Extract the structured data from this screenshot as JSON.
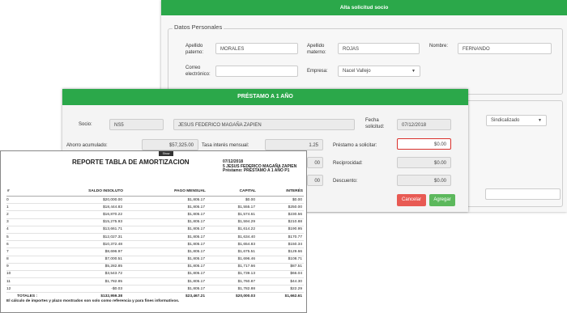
{
  "alta": {
    "title": "Alta solicitud socio",
    "section": "Datos Personales",
    "apellido_paterno_label": "Apellido paterno:",
    "apellido_paterno_value": "MORALES",
    "apellido_materno_label": "Apellido materno:",
    "apellido_materno_value": "ROJAS",
    "nombre_label": "Nombre:",
    "nombre_value": "FERNANDO",
    "correo_label": "Correo electrónico:",
    "correo_value": "",
    "empresa_label": "Empresa:",
    "empresa_value": "Nacel Vallejo",
    "sindicalizado_value": "Sindicalizado"
  },
  "prestamo": {
    "title": "PRÉSTAMO A 1 AÑO",
    "socio_label": "Socio:",
    "socio_id": "NS5",
    "socio_name": "JESUS FEDERICO MAGAÑA ZAPIEN",
    "fecha_label": "Fecha solicitud:",
    "fecha_value": "07/12/2018",
    "ahorro_label": "Ahorro acumulado:",
    "ahorro_value": "$57,325.00",
    "tasa_label": "Tasa interés mensual:",
    "tasa_value": "1.25",
    "prestamo_label": "Préstamo a solicitar:",
    "prestamo_value": "$0.00",
    "reciprocidad_label": "Reciprocidad:",
    "reciprocidad_value": "$0.00",
    "descuento_label": "Descuento:",
    "descuento_value": "$0.00",
    "hidden_value_1": "00",
    "hidden_value_2": "00",
    "cancelar": "Cancelar",
    "agregar": "Agregar"
  },
  "reporte": {
    "toolbar": "Show",
    "title": "REPORTE TABLA DE AMORTIZACION",
    "info_date": "07/12/2018",
    "info_socio": "5 JESUS FEDERICO MAGAÑA ZAPIEN",
    "info_prestamo": "Préstamo: PRÉSTAMO A 1 AÑO P1",
    "columns": [
      "#",
      "SALDO INSOLUTO",
      "PAGO MENSUAL",
      "CAPITAL",
      "INTERÉS"
    ],
    "rows": [
      [
        "0",
        "$20,000.00",
        "$1,805.17",
        "$0.00",
        "$0.00"
      ],
      [
        "1",
        "$18,444.83",
        "$1,805.17",
        "$1,555.17",
        "$250.00"
      ],
      [
        "2",
        "$16,870.22",
        "$1,805.17",
        "$1,574.61",
        "$230.56"
      ],
      [
        "3",
        "$15,275.93",
        "$1,805.17",
        "$1,594.29",
        "$210.88"
      ],
      [
        "4",
        "$13,661.71",
        "$1,805.17",
        "$1,614.22",
        "$190.95"
      ],
      [
        "5",
        "$12,027.31",
        "$1,805.17",
        "$1,634.40",
        "$170.77"
      ],
      [
        "6",
        "$10,372.48",
        "$1,805.17",
        "$1,654.83",
        "$150.34"
      ],
      [
        "7",
        "$8,696.97",
        "$1,805.17",
        "$1,675.51",
        "$129.66"
      ],
      [
        "8",
        "$7,000.51",
        "$1,805.17",
        "$1,696.46",
        "$108.71"
      ],
      [
        "9",
        "$5,282.85",
        "$1,805.17",
        "$1,717.66",
        "$87.51"
      ],
      [
        "10",
        "$3,543.72",
        "$1,805.17",
        "$1,739.13",
        "$66.04"
      ],
      [
        "11",
        "$1,782.85",
        "$1,805.17",
        "$1,760.87",
        "$44.30"
      ],
      [
        "12",
        "-$0.03",
        "$1,805.17",
        "$1,782.88",
        "$22.29"
      ]
    ],
    "totals": [
      "TOTALES :",
      "$132,959.38",
      "$23,467.21",
      "$20,000.03",
      "$1,662.61"
    ],
    "note": "El cálculo de importes y plazo mostrados son solo como referencia y para fines informativos."
  }
}
